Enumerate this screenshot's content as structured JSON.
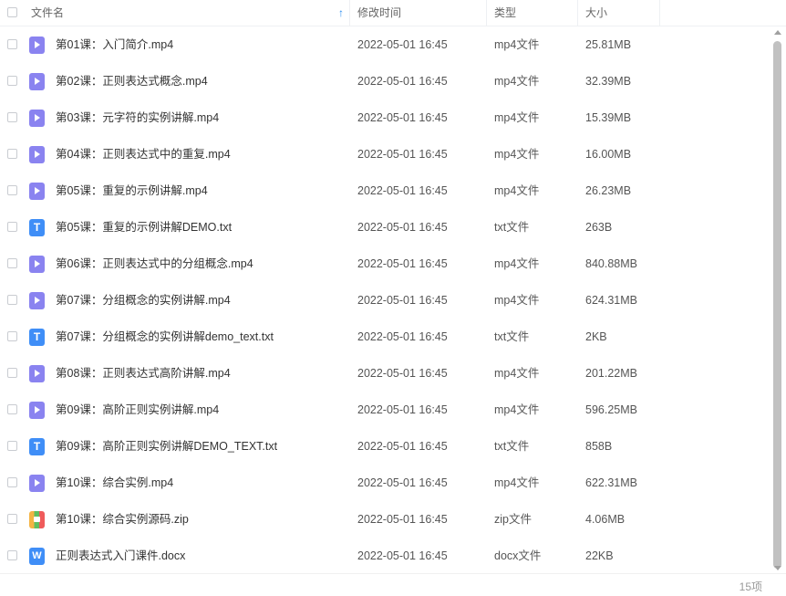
{
  "header": {
    "name": "文件名",
    "time": "修改时间",
    "type": "类型",
    "size": "大小",
    "sort_arrow": "↑"
  },
  "files": [
    {
      "icon": "video-file-icon",
      "glyph": "",
      "name": "第01课：入门简介.mp4",
      "time": "2022-05-01 16:45",
      "type": "mp4文件",
      "size": "25.81MB"
    },
    {
      "icon": "video-file-icon",
      "glyph": "",
      "name": "第02课：正则表达式概念.mp4",
      "time": "2022-05-01 16:45",
      "type": "mp4文件",
      "size": "32.39MB"
    },
    {
      "icon": "video-file-icon",
      "glyph": "",
      "name": "第03课：元字符的实例讲解.mp4",
      "time": "2022-05-01 16:45",
      "type": "mp4文件",
      "size": "15.39MB"
    },
    {
      "icon": "video-file-icon",
      "glyph": "",
      "name": "第04课：正则表达式中的重复.mp4",
      "time": "2022-05-01 16:45",
      "type": "mp4文件",
      "size": "16.00MB"
    },
    {
      "icon": "video-file-icon",
      "glyph": "",
      "name": "第05课：重复的示例讲解.mp4",
      "time": "2022-05-01 16:45",
      "type": "mp4文件",
      "size": "26.23MB"
    },
    {
      "icon": "text-file-icon",
      "glyph": "T",
      "name": "第05课：重复的示例讲解DEMO.txt",
      "time": "2022-05-01 16:45",
      "type": "txt文件",
      "size": "263B"
    },
    {
      "icon": "video-file-icon",
      "glyph": "",
      "name": "第06课：正则表达式中的分组概念.mp4",
      "time": "2022-05-01 16:45",
      "type": "mp4文件",
      "size": "840.88MB"
    },
    {
      "icon": "video-file-icon",
      "glyph": "",
      "name": "第07课：分组概念的实例讲解.mp4",
      "time": "2022-05-01 16:45",
      "type": "mp4文件",
      "size": "624.31MB"
    },
    {
      "icon": "text-file-icon",
      "glyph": "T",
      "name": "第07课：分组概念的实例讲解demo_text.txt",
      "time": "2022-05-01 16:45",
      "type": "txt文件",
      "size": "2KB"
    },
    {
      "icon": "video-file-icon",
      "glyph": "",
      "name": "第08课：正则表达式高阶讲解.mp4",
      "time": "2022-05-01 16:45",
      "type": "mp4文件",
      "size": "201.22MB"
    },
    {
      "icon": "video-file-icon",
      "glyph": "",
      "name": "第09课：高阶正则实例讲解.mp4",
      "time": "2022-05-01 16:45",
      "type": "mp4文件",
      "size": "596.25MB"
    },
    {
      "icon": "text-file-icon",
      "glyph": "T",
      "name": "第09课：高阶正则实例讲解DEMO_TEXT.txt",
      "time": "2022-05-01 16:45",
      "type": "txt文件",
      "size": "858B"
    },
    {
      "icon": "video-file-icon",
      "glyph": "",
      "name": "第10课：综合实例.mp4",
      "time": "2022-05-01 16:45",
      "type": "mp4文件",
      "size": "622.31MB"
    },
    {
      "icon": "zip-file-icon",
      "glyph": "",
      "name": "第10课：综合实例源码.zip",
      "time": "2022-05-01 16:45",
      "type": "zip文件",
      "size": "4.06MB"
    },
    {
      "icon": "word-file-icon",
      "glyph": "W",
      "name": "正则表达式入门课件.docx",
      "time": "2022-05-01 16:45",
      "type": "docx文件",
      "size": "22KB"
    }
  ],
  "footer": {
    "count": "15项"
  }
}
